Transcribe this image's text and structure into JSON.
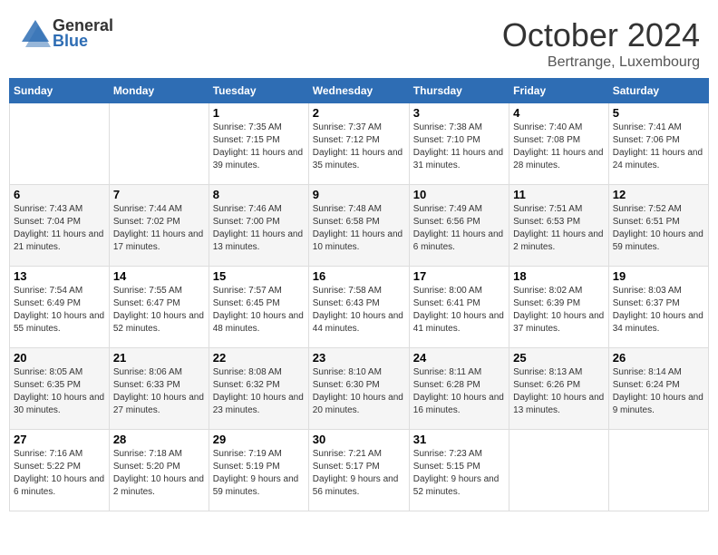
{
  "header": {
    "logo_general": "General",
    "logo_blue": "Blue",
    "month": "October 2024",
    "location": "Bertrange, Luxembourg"
  },
  "weekdays": [
    "Sunday",
    "Monday",
    "Tuesday",
    "Wednesday",
    "Thursday",
    "Friday",
    "Saturday"
  ],
  "weeks": [
    {
      "rowClass": "row-white",
      "days": [
        {
          "date": "",
          "info": ""
        },
        {
          "date": "",
          "info": ""
        },
        {
          "date": "1",
          "info": "Sunrise: 7:35 AM\nSunset: 7:15 PM\nDaylight: 11 hours and 39 minutes."
        },
        {
          "date": "2",
          "info": "Sunrise: 7:37 AM\nSunset: 7:12 PM\nDaylight: 11 hours and 35 minutes."
        },
        {
          "date": "3",
          "info": "Sunrise: 7:38 AM\nSunset: 7:10 PM\nDaylight: 11 hours and 31 minutes."
        },
        {
          "date": "4",
          "info": "Sunrise: 7:40 AM\nSunset: 7:08 PM\nDaylight: 11 hours and 28 minutes."
        },
        {
          "date": "5",
          "info": "Sunrise: 7:41 AM\nSunset: 7:06 PM\nDaylight: 11 hours and 24 minutes."
        }
      ]
    },
    {
      "rowClass": "row-alt",
      "days": [
        {
          "date": "6",
          "info": "Sunrise: 7:43 AM\nSunset: 7:04 PM\nDaylight: 11 hours and 21 minutes."
        },
        {
          "date": "7",
          "info": "Sunrise: 7:44 AM\nSunset: 7:02 PM\nDaylight: 11 hours and 17 minutes."
        },
        {
          "date": "8",
          "info": "Sunrise: 7:46 AM\nSunset: 7:00 PM\nDaylight: 11 hours and 13 minutes."
        },
        {
          "date": "9",
          "info": "Sunrise: 7:48 AM\nSunset: 6:58 PM\nDaylight: 11 hours and 10 minutes."
        },
        {
          "date": "10",
          "info": "Sunrise: 7:49 AM\nSunset: 6:56 PM\nDaylight: 11 hours and 6 minutes."
        },
        {
          "date": "11",
          "info": "Sunrise: 7:51 AM\nSunset: 6:53 PM\nDaylight: 11 hours and 2 minutes."
        },
        {
          "date": "12",
          "info": "Sunrise: 7:52 AM\nSunset: 6:51 PM\nDaylight: 10 hours and 59 minutes."
        }
      ]
    },
    {
      "rowClass": "row-white",
      "days": [
        {
          "date": "13",
          "info": "Sunrise: 7:54 AM\nSunset: 6:49 PM\nDaylight: 10 hours and 55 minutes."
        },
        {
          "date": "14",
          "info": "Sunrise: 7:55 AM\nSunset: 6:47 PM\nDaylight: 10 hours and 52 minutes."
        },
        {
          "date": "15",
          "info": "Sunrise: 7:57 AM\nSunset: 6:45 PM\nDaylight: 10 hours and 48 minutes."
        },
        {
          "date": "16",
          "info": "Sunrise: 7:58 AM\nSunset: 6:43 PM\nDaylight: 10 hours and 44 minutes."
        },
        {
          "date": "17",
          "info": "Sunrise: 8:00 AM\nSunset: 6:41 PM\nDaylight: 10 hours and 41 minutes."
        },
        {
          "date": "18",
          "info": "Sunrise: 8:02 AM\nSunset: 6:39 PM\nDaylight: 10 hours and 37 minutes."
        },
        {
          "date": "19",
          "info": "Sunrise: 8:03 AM\nSunset: 6:37 PM\nDaylight: 10 hours and 34 minutes."
        }
      ]
    },
    {
      "rowClass": "row-alt",
      "days": [
        {
          "date": "20",
          "info": "Sunrise: 8:05 AM\nSunset: 6:35 PM\nDaylight: 10 hours and 30 minutes."
        },
        {
          "date": "21",
          "info": "Sunrise: 8:06 AM\nSunset: 6:33 PM\nDaylight: 10 hours and 27 minutes."
        },
        {
          "date": "22",
          "info": "Sunrise: 8:08 AM\nSunset: 6:32 PM\nDaylight: 10 hours and 23 minutes."
        },
        {
          "date": "23",
          "info": "Sunrise: 8:10 AM\nSunset: 6:30 PM\nDaylight: 10 hours and 20 minutes."
        },
        {
          "date": "24",
          "info": "Sunrise: 8:11 AM\nSunset: 6:28 PM\nDaylight: 10 hours and 16 minutes."
        },
        {
          "date": "25",
          "info": "Sunrise: 8:13 AM\nSunset: 6:26 PM\nDaylight: 10 hours and 13 minutes."
        },
        {
          "date": "26",
          "info": "Sunrise: 8:14 AM\nSunset: 6:24 PM\nDaylight: 10 hours and 9 minutes."
        }
      ]
    },
    {
      "rowClass": "row-white",
      "days": [
        {
          "date": "27",
          "info": "Sunrise: 7:16 AM\nSunset: 5:22 PM\nDaylight: 10 hours and 6 minutes."
        },
        {
          "date": "28",
          "info": "Sunrise: 7:18 AM\nSunset: 5:20 PM\nDaylight: 10 hours and 2 minutes."
        },
        {
          "date": "29",
          "info": "Sunrise: 7:19 AM\nSunset: 5:19 PM\nDaylight: 9 hours and 59 minutes."
        },
        {
          "date": "30",
          "info": "Sunrise: 7:21 AM\nSunset: 5:17 PM\nDaylight: 9 hours and 56 minutes."
        },
        {
          "date": "31",
          "info": "Sunrise: 7:23 AM\nSunset: 5:15 PM\nDaylight: 9 hours and 52 minutes."
        },
        {
          "date": "",
          "info": ""
        },
        {
          "date": "",
          "info": ""
        }
      ]
    }
  ]
}
